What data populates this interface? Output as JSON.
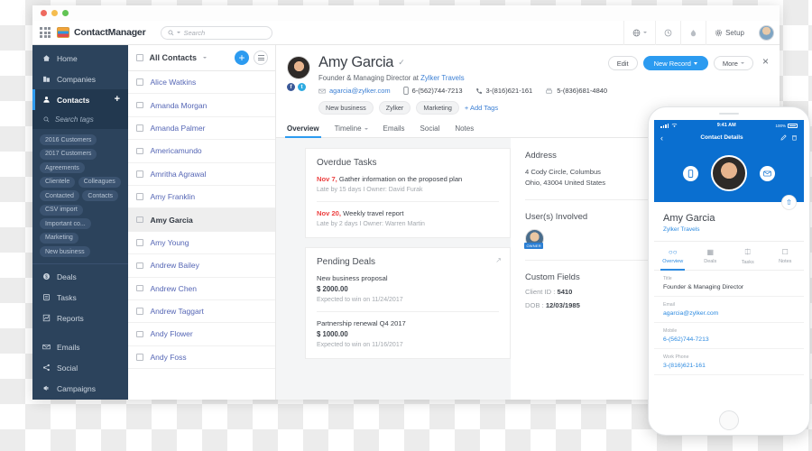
{
  "appbar": {
    "brand_name": "ContactManager",
    "search_placeholder": "Search",
    "setup_label": "Setup",
    "icons": {
      "apps": "grid-apps-icon",
      "globe": "globe-icon",
      "clock": "clock-icon",
      "drop": "drop-icon",
      "gear": "gear-icon"
    }
  },
  "sidebar": {
    "items": [
      {
        "label": "Home",
        "icon": "home-icon",
        "active": false
      },
      {
        "label": "Companies",
        "icon": "building-icon",
        "active": false
      },
      {
        "label": "Contacts",
        "icon": "person-icon",
        "active": true
      }
    ],
    "tag_search_placeholder": "Search tags",
    "tags": [
      "2016 Customers",
      "2017 Customers",
      "Agreements",
      "Clientele",
      "Colleagues",
      "Contacted",
      "Contacts",
      "CSV import",
      "Important co...",
      "Marketing",
      "New business"
    ],
    "items2": [
      {
        "label": "Deals",
        "icon": "dollar-circle-icon"
      },
      {
        "label": "Tasks",
        "icon": "clipboard-icon"
      },
      {
        "label": "Reports",
        "icon": "chart-icon"
      }
    ],
    "items3": [
      {
        "label": "Emails",
        "icon": "envelope-icon"
      },
      {
        "label": "Social",
        "icon": "share-icon"
      },
      {
        "label": "Campaigns",
        "icon": "megaphone-icon"
      }
    ]
  },
  "list": {
    "header_label": "All Contacts",
    "add_label": "+",
    "contacts": [
      {
        "name": "Alice Watkins",
        "selected": false
      },
      {
        "name": "Amanda Morgan",
        "selected": false
      },
      {
        "name": "Amanda Palmer",
        "selected": false
      },
      {
        "name": "Americamundo",
        "selected": false
      },
      {
        "name": "Amritha Agrawal",
        "selected": false
      },
      {
        "name": "Amy Franklin",
        "selected": false
      },
      {
        "name": "Amy Garcia",
        "selected": true
      },
      {
        "name": "Amy Young",
        "selected": false
      },
      {
        "name": "Andrew Bailey",
        "selected": false
      },
      {
        "name": "Andrew Chen",
        "selected": false
      },
      {
        "name": "Andrew Taggart",
        "selected": false
      },
      {
        "name": "Andy Flower",
        "selected": false
      },
      {
        "name": "Andy Foss",
        "selected": false
      }
    ]
  },
  "detail": {
    "name": "Amy Garcia",
    "verified_icon": "verified-check-icon",
    "title_prefix": "Founder & Managing Director at",
    "company": "Zylker Travels",
    "email": "agarcia@zylker.com",
    "mobile": "6-(562)744-7213",
    "phone": "3-(816)621-161",
    "fax": "5-(836)681-4840",
    "tags": [
      "New business",
      "Zylker",
      "Marketing"
    ],
    "add_tags_label": "+ Add Tags",
    "actions": {
      "edit": "Edit",
      "new_record": "New Record",
      "more": "More",
      "close": "×"
    },
    "tabs": [
      {
        "label": "Overview",
        "active": true,
        "caret": false
      },
      {
        "label": "Timeline",
        "active": false,
        "caret": true
      },
      {
        "label": "Emails",
        "active": false,
        "caret": false
      },
      {
        "label": "Social",
        "active": false,
        "caret": false
      },
      {
        "label": "Notes",
        "active": false,
        "caret": false
      }
    ],
    "overdue_tasks": {
      "title": "Overdue Tasks",
      "items": [
        {
          "date": "Nov 7,",
          "task": "Gather information on the proposed plan",
          "meta": "Late by 15 days I Owner: David Furak"
        },
        {
          "date": "Nov 20,",
          "task": "Weekly travel report",
          "meta": "Late by 2 days I Owner: Warren Martin"
        }
      ]
    },
    "pending_deals": {
      "title": "Pending Deals",
      "items": [
        {
          "name": "New business proposal",
          "amount": "$ 2000.00",
          "meta": "Expected to win on 11/24/2017"
        },
        {
          "name": "Partnership renewal Q4 2017",
          "amount": "$ 1000.00",
          "meta": "Expected to win on 11/16/2017"
        }
      ]
    },
    "address": {
      "title": "Address",
      "line1": "4 Cody Circle, Columbus",
      "line2": "Ohio, 43004 United States"
    },
    "users_involved": {
      "title": "User(s) Involved",
      "badge": "OWNER"
    },
    "custom_fields": {
      "title": "Custom Fields",
      "rows": [
        {
          "label": "Client ID :",
          "value": "5410"
        },
        {
          "label": "DOB :",
          "value": "12/03/1985"
        }
      ]
    }
  },
  "phone": {
    "status": {
      "time": "9:41 AM",
      "battery": "100%"
    },
    "nav": {
      "back": "‹",
      "title": "Contact Details",
      "edit_icon": "pencil-icon",
      "delete_icon": "trash-icon"
    },
    "hero": {
      "call_icon": "phone-icon",
      "message_icon": "message-icon",
      "share_icon": "share-up-icon"
    },
    "name": "Amy Garcia",
    "company": "Zylker Travels",
    "tabs": [
      {
        "label": "Overview",
        "icon": "rings-icon",
        "active": true
      },
      {
        "label": "Deals",
        "icon": "deals-icon",
        "active": false
      },
      {
        "label": "Tasks",
        "icon": "clipboard-icon",
        "active": false
      },
      {
        "label": "Notes",
        "icon": "notes-icon",
        "active": false
      }
    ],
    "fields": [
      {
        "label": "Title",
        "value": "Founder & Managing Director",
        "link": false
      },
      {
        "label": "Email",
        "value": "agarcia@zylker.com",
        "link": true
      },
      {
        "label": "Mobile",
        "value": "6-(562)744-7213",
        "link": true
      },
      {
        "label": "Work Phone",
        "value": "3-(816)621-161",
        "link": true
      }
    ]
  }
}
